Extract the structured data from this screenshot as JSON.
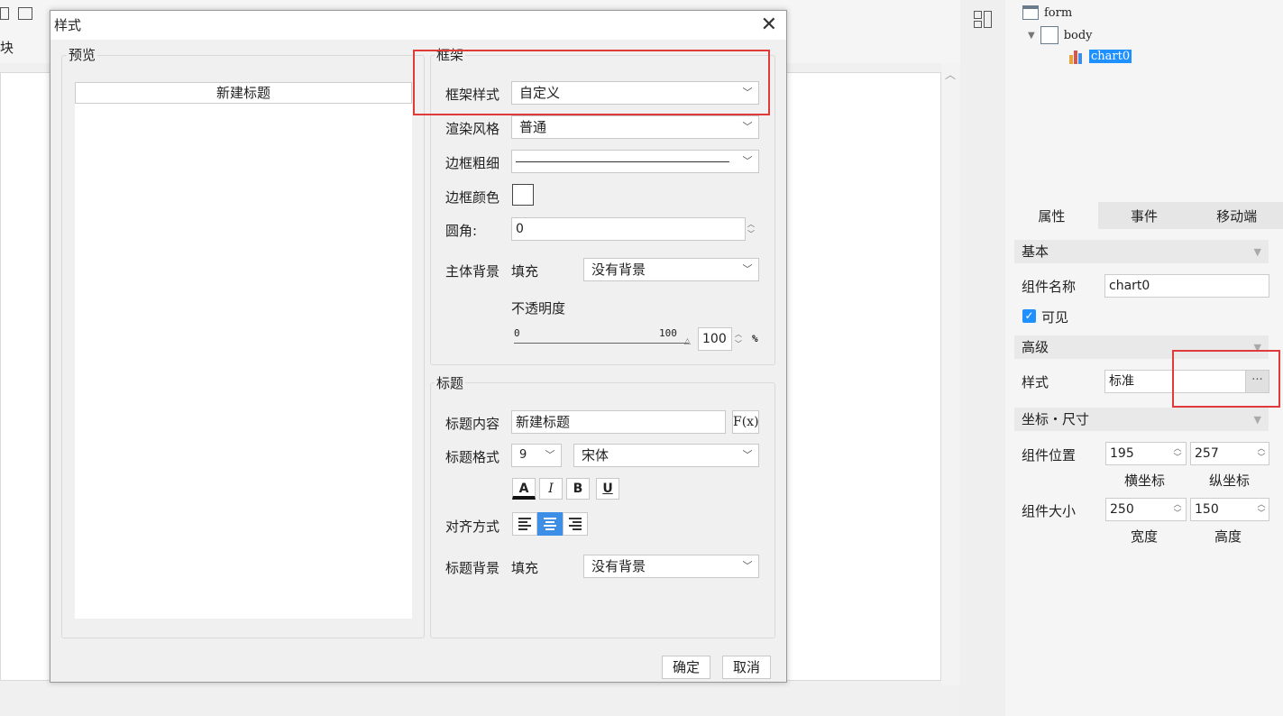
{
  "background": {
    "toolbar_label": "块",
    "tree": {
      "form": "form",
      "body": "body",
      "chart": "chart0"
    }
  },
  "properties_panel": {
    "tabs": [
      "属性",
      "事件",
      "移动端"
    ],
    "basic": {
      "header": "基本",
      "component_name_label": "组件名称",
      "component_name_value": "chart0",
      "visible_label": "可见",
      "visible_checked": true
    },
    "advanced": {
      "header": "高级",
      "style_label": "样式",
      "style_value": "标准",
      "style_button": "···"
    },
    "coords": {
      "header": "坐标・尺寸",
      "position_label": "组件位置",
      "x_value": "195",
      "y_value": "257",
      "x_caption": "横坐标",
      "y_caption": "纵坐标",
      "size_label": "组件大小",
      "width_value": "250",
      "height_value": "150",
      "width_caption": "宽度",
      "height_caption": "高度"
    }
  },
  "dialog": {
    "title": "样式",
    "preview": {
      "group_title": "预览",
      "chart_title": "新建标题"
    },
    "frame": {
      "group_title": "框架",
      "frame_style_label": "框架样式",
      "frame_style_value": "自定义",
      "render_style_label": "渲染风格",
      "render_style_value": "普通",
      "border_width_label": "边框粗细",
      "border_color_label": "边框颜色",
      "corner_label": "圆角:",
      "corner_value": "0",
      "body_bg_label": "主体背景",
      "body_bg_fill": "填充",
      "body_bg_value": "没有背景",
      "opacity_label": "不透明度",
      "slider_min": "0",
      "slider_max": "100",
      "opacity_value": "100",
      "opacity_unit": "%"
    },
    "title_section": {
      "group_title": "标题",
      "content_label": "标题内容",
      "content_value": "新建标题",
      "fx_label": "F(x)",
      "format_label": "标题格式",
      "font_size": "9",
      "font_name": "宋体",
      "color_btn": "A",
      "italic_btn": "I",
      "bold_btn": "B",
      "underline_btn": "U",
      "align_label": "对齐方式",
      "align_selected": "center",
      "title_bg_label": "标题背景",
      "title_bg_fill": "填充",
      "title_bg_value": "没有背景"
    },
    "ok_button": "确定",
    "cancel_button": "取消"
  },
  "colors": {
    "accent": "#3c8ee6",
    "highlight_box": "#e03a3a",
    "tree_selected": "#1e90ff"
  }
}
